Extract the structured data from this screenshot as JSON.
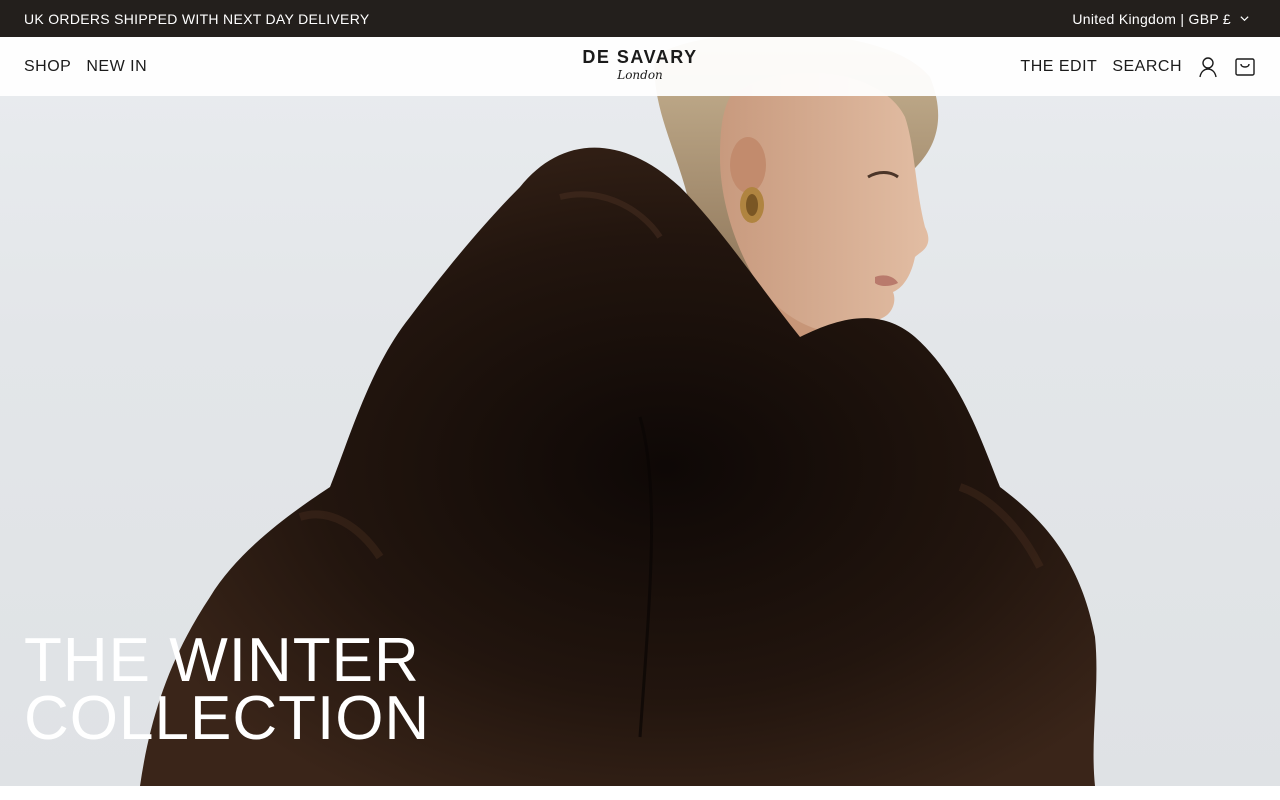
{
  "announcement": {
    "text": "UK ORDERS SHIPPED WITH NEXT DAY DELIVERY",
    "region": "United Kingdom | GBP £"
  },
  "header": {
    "nav_left": [
      {
        "label": "SHOP"
      },
      {
        "label": "NEW IN"
      }
    ],
    "logo": {
      "main": "DE SAVARY",
      "sub": "London"
    },
    "nav_right": [
      {
        "label": "THE EDIT"
      },
      {
        "label": "SEARCH"
      }
    ],
    "icons": [
      "account-icon",
      "cart-icon"
    ]
  },
  "hero": {
    "headline_line1": "THE WINTER",
    "headline_line2": "COLLECTION"
  },
  "colors": {
    "announcement_bg": "#231f1c",
    "text_dark": "#1b1b1b",
    "hero_bg": "#e5e8eb",
    "fur": "#1e130d"
  }
}
